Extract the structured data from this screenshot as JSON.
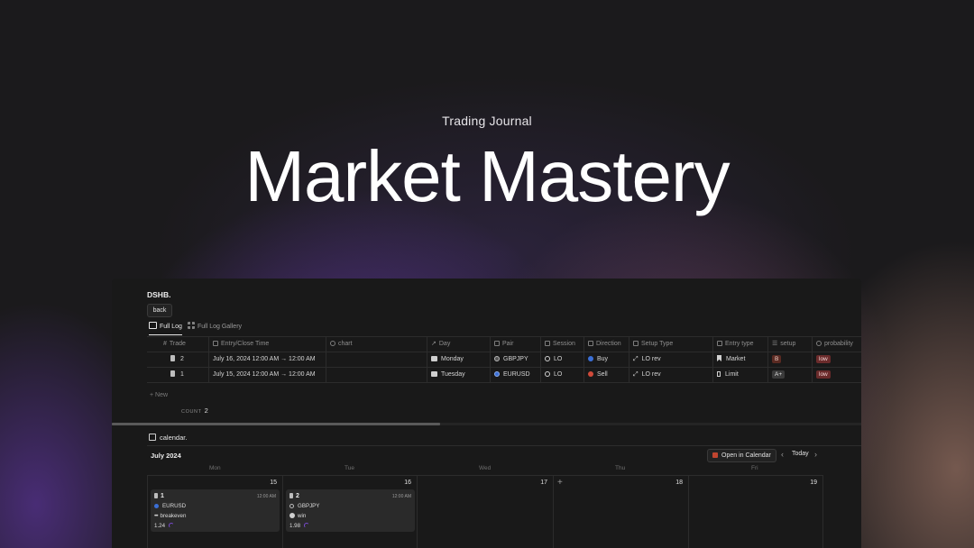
{
  "hero": {
    "subtitle": "Trading Journal",
    "title": "Market Mastery"
  },
  "panel": {
    "title": "DSHB.",
    "back_label": "back",
    "tabs": [
      {
        "label": "Full Log",
        "active": true
      },
      {
        "label": "Full Log Gallery",
        "active": false
      }
    ],
    "columns": [
      "Trade",
      "Entry/Close Time",
      "chart",
      "Day",
      "Pair",
      "Session",
      "Direction",
      "Setup Type",
      "Entry type",
      "setup",
      "probability"
    ],
    "rows": [
      {
        "trade": "2",
        "time": "July 16, 2024 12:00 AM → 12:00 AM",
        "chart": "",
        "day": "Monday",
        "pair": "GBPJPY",
        "session": "LO",
        "direction": "Buy",
        "setup_type": "LO rev",
        "entry_type": "Market",
        "setup": "B",
        "probability": "low"
      },
      {
        "trade": "1",
        "time": "July 15, 2024 12:00 AM → 12:00 AM",
        "chart": "",
        "day": "Tuesday",
        "pair": "EURUSD",
        "session": "LO",
        "direction": "Sell",
        "setup_type": "LO rev",
        "entry_type": "Limit",
        "setup": "A+",
        "probability": "low"
      }
    ],
    "new_label": "+ New",
    "count_label": "COUNT",
    "count_value": "2"
  },
  "calendar": {
    "heading": "calendar.",
    "month": "July 2024",
    "open_label": "Open in Calendar",
    "today_label": "Today",
    "prev": "‹",
    "next": "›",
    "weekdays": [
      "Mon",
      "Tue",
      "Wed",
      "Thu",
      "Fri"
    ],
    "days": [
      "15",
      "16",
      "17",
      "18",
      "19"
    ],
    "cards": [
      {
        "trade": "1",
        "time": "12:00 AM",
        "pair": "EURUSD",
        "result": "breakeven",
        "rr": "1.24"
      },
      {
        "trade": "2",
        "time": "12:00 AM",
        "pair": "GBPJPY",
        "result": "win",
        "rr": "1.98"
      }
    ]
  },
  "colors": {
    "background": "#1b1a1c",
    "panel": "#191919",
    "purple_glow": "#7640c8",
    "tag_low": "#6a2b2b",
    "tag_b": "#5a2a22",
    "buy": "#3b6fd6",
    "sell": "#d04a3a"
  }
}
